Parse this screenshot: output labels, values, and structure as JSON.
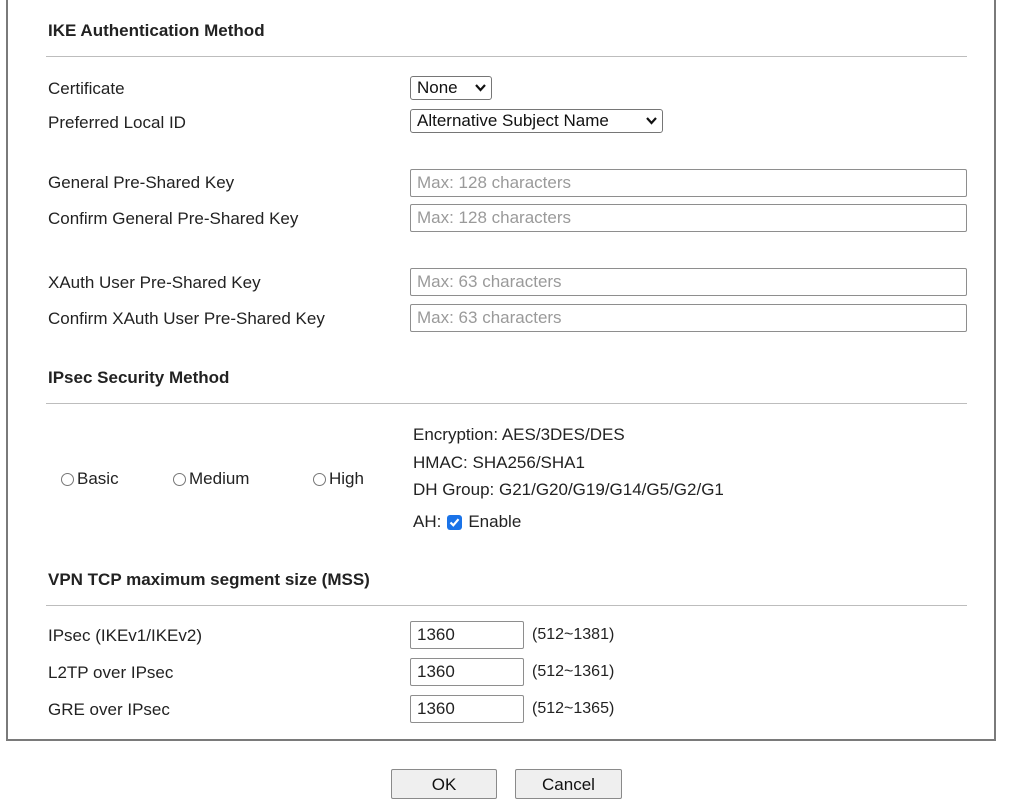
{
  "ike": {
    "title": "IKE Authentication Method",
    "certificate_label": "Certificate",
    "certificate_value": "None",
    "local_id_label": "Preferred Local ID",
    "local_id_value": "Alternative Subject Name",
    "general_psk_label": "General Pre-Shared Key",
    "general_psk_placeholder": "Max: 128 characters",
    "confirm_general_psk_label": "Confirm General Pre-Shared Key",
    "confirm_general_psk_placeholder": "Max: 128 characters",
    "xauth_psk_label": "XAuth User Pre-Shared Key",
    "xauth_psk_placeholder": "Max: 63 characters",
    "confirm_xauth_psk_label": "Confirm XAuth User Pre-Shared Key",
    "confirm_xauth_psk_placeholder": "Max: 63 characters"
  },
  "ipsec": {
    "title": "IPsec Security Method",
    "options": [
      "Basic",
      "Medium",
      "High"
    ],
    "encryption": "Encryption: AES/3DES/DES",
    "hmac": "HMAC: SHA256/SHA1",
    "dh_group": "DH Group: G21/G20/G19/G14/G5/G2/G1",
    "ah_label": "AH:",
    "ah_enable_label": "Enable",
    "ah_enabled": true
  },
  "mss": {
    "title": "VPN TCP maximum segment size (MSS)",
    "rows": [
      {
        "label": "IPsec (IKEv1/IKEv2)",
        "value": "1360",
        "range": "(512~1381)"
      },
      {
        "label": "L2TP over IPsec",
        "value": "1360",
        "range": "(512~1361)"
      },
      {
        "label": "GRE over IPsec",
        "value": "1360",
        "range": "(512~1365)"
      }
    ]
  },
  "actions": {
    "ok_label": "OK",
    "cancel_label": "Cancel"
  },
  "colors": {
    "checkbox_accent": "#1a73e8",
    "border": "#7a7a7a"
  }
}
